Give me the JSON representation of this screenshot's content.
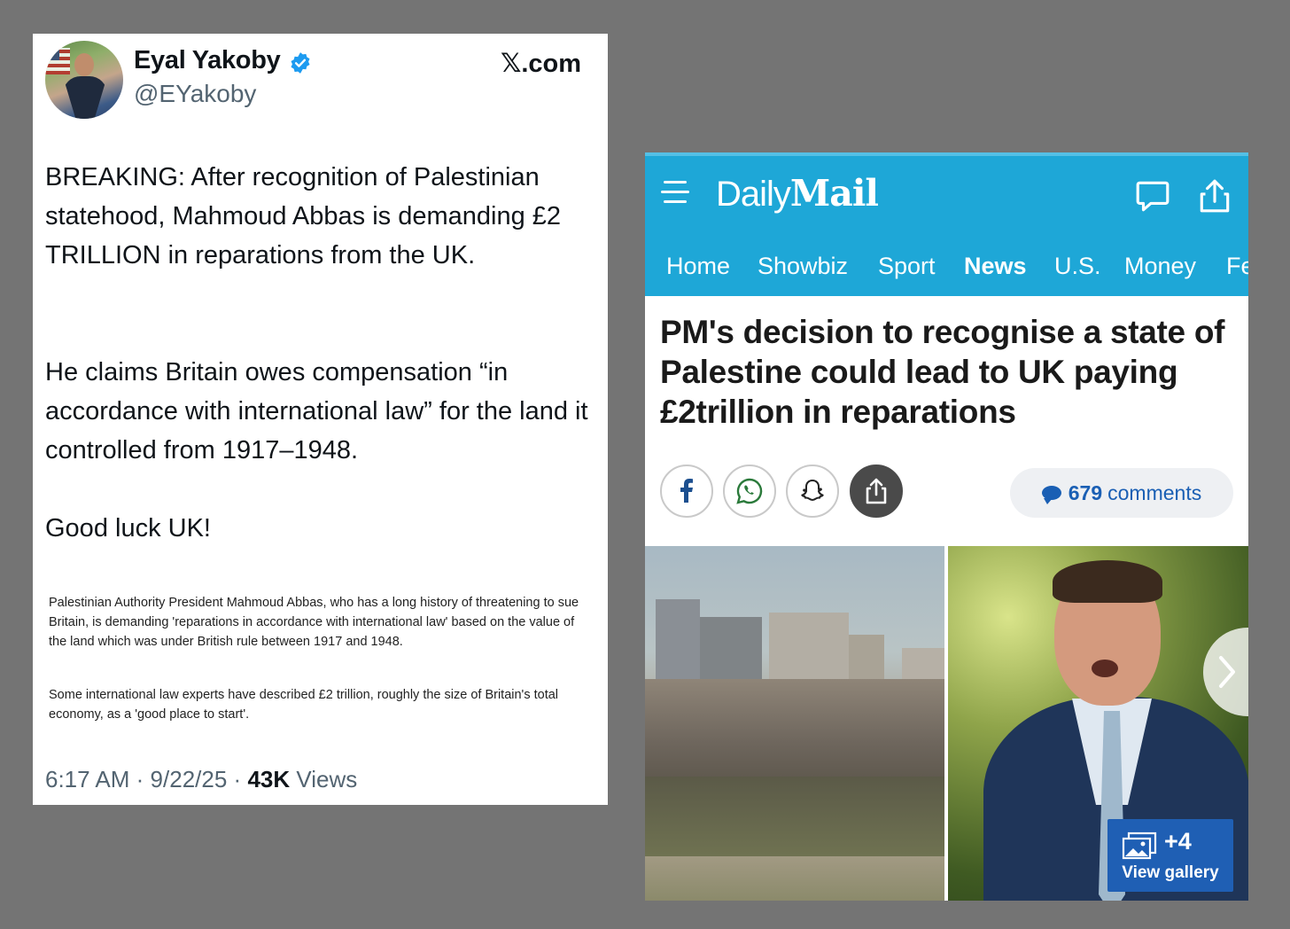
{
  "tweet": {
    "display_name": "Eyal Yakoby",
    "handle": "@EYakoby",
    "source": "X.com",
    "source_letter": "𝕏",
    "source_rest": ".com",
    "paragraph1": "BREAKING: After recognition of Palestinian statehood, Mahmoud Abbas is demanding £2 TRILLION in reparations from the UK.",
    "paragraph2": "He claims Britain owes compensation “in accordance with international law” for the land it controlled from 1917–1948.",
    "paragraph3": "Good luck UK!",
    "quote1": "Palestinian Authority President Mahmoud Abbas, who has a long history of threatening to sue Britain, is demanding 'reparations in accordance with international law' based on the value of the land which was under British rule between 1917 and 1948.",
    "quote2": "Some international law experts have described £2 trillion, roughly the size of Britain's total economy, as a 'good place to start'.",
    "time": "6:17 AM",
    "date": "9/22/25",
    "views_count": "43K",
    "views_label": "Views",
    "separator": "·",
    "colors": {
      "verified": "#1d9bf0",
      "text": "#0f1419",
      "muted": "#536471"
    }
  },
  "dailymail": {
    "logo_daily": "Daily",
    "logo_mail": "Mail",
    "nav": [
      "Home",
      "Showbiz",
      "Sport",
      "News",
      "U.S.",
      "Money",
      "Fe"
    ],
    "active_nav": "News",
    "headline": "PM's decision to recognise a state of Palestine could lead to UK paying £2trillion in reparations",
    "comments_count": "679",
    "comments_label": "comments",
    "gallery_count": "+4",
    "gallery_label": "View gallery",
    "share_icons": [
      "facebook-icon",
      "whatsapp-icon",
      "snapchat-icon",
      "share-icon"
    ],
    "header_icons": [
      "menu-icon",
      "comment-bubble-icon",
      "share-icon"
    ],
    "colors": {
      "header": "#1ea7d7",
      "link": "#1a5fb4",
      "gallery": "#1f5fb4"
    }
  }
}
